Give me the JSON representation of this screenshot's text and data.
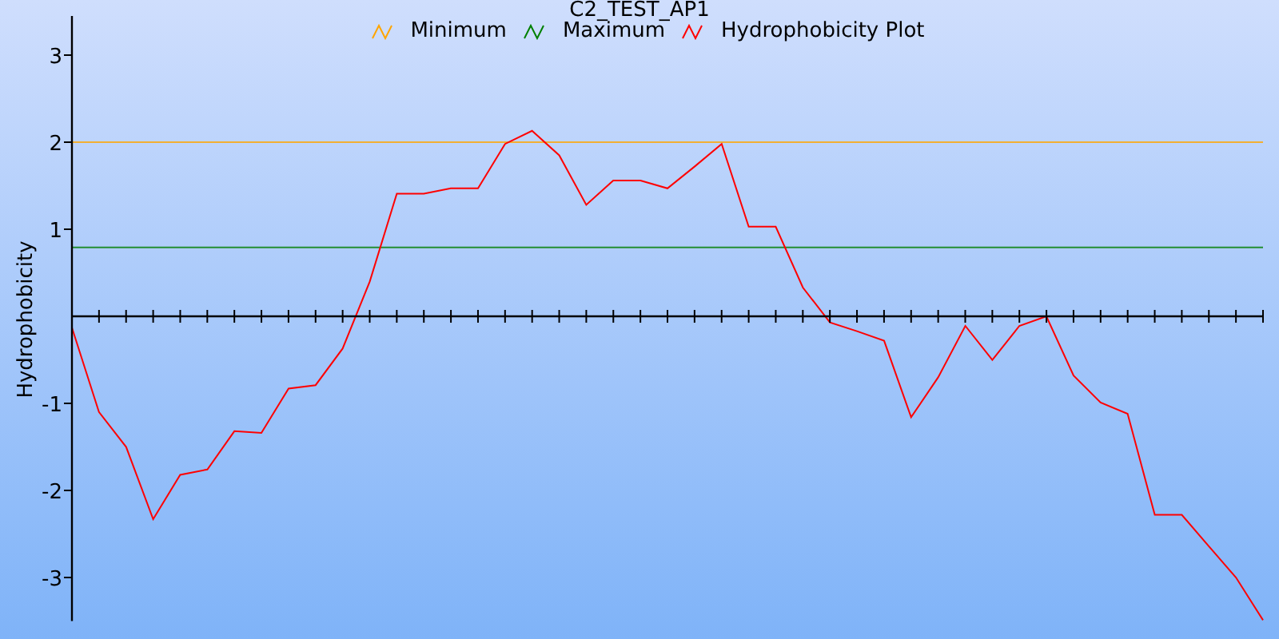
{
  "plot": {
    "chart_data": {
      "type": "line",
      "title": "C2_TEST_AP1",
      "legend": "top",
      "ylabel": "Hydrophobicity",
      "ylim": [
        -3.5,
        3.45
      ],
      "yticks": [
        -3,
        -2,
        -1,
        1,
        2,
        3
      ],
      "series": [
        {
          "name": "Minimum",
          "color": "#ffa500",
          "values": [
            2,
            2,
            2,
            2,
            2,
            2,
            2,
            2,
            2,
            2,
            2,
            2,
            2,
            2,
            2,
            2,
            2,
            2,
            2,
            2,
            2,
            2,
            2,
            2,
            2,
            2,
            2,
            2,
            2,
            2,
            2,
            2,
            2,
            2,
            2,
            2,
            2,
            2,
            2,
            2,
            2,
            2,
            2,
            2,
            2
          ]
        },
        {
          "name": "Maximum",
          "color": "#008000",
          "values": [
            0.79,
            0.79,
            0.79,
            0.79,
            0.79,
            0.79,
            0.79,
            0.79,
            0.79,
            0.79,
            0.79,
            0.79,
            0.79,
            0.79,
            0.79,
            0.79,
            0.79,
            0.79,
            0.79,
            0.79,
            0.79,
            0.79,
            0.79,
            0.79,
            0.79,
            0.79,
            0.79,
            0.79,
            0.79,
            0.79,
            0.79,
            0.79,
            0.79,
            0.79,
            0.79,
            0.79,
            0.79,
            0.79,
            0.79,
            0.79,
            0.79,
            0.79,
            0.79,
            0.79,
            0.79
          ]
        },
        {
          "name": "Hydrophobicity Plot",
          "color": "#ff0000",
          "values": [
            -0.13,
            -1.1,
            -1.5,
            -2.33,
            -1.82,
            -1.76,
            -1.32,
            -1.34,
            -0.83,
            -0.79,
            -0.37,
            0.4,
            1.41,
            1.41,
            1.47,
            1.47,
            1.98,
            2.13,
            1.85,
            1.28,
            1.56,
            1.56,
            1.47,
            1.72,
            1.98,
            1.03,
            1.03,
            0.33,
            -0.07,
            -0.17,
            -0.28,
            -1.16,
            -0.7,
            -0.11,
            -0.5,
            -0.11,
            0,
            -0.68,
            -0.99,
            -1.12,
            -2.28,
            -2.28,
            -2.64,
            -3,
            -3.49
          ]
        }
      ]
    }
  }
}
